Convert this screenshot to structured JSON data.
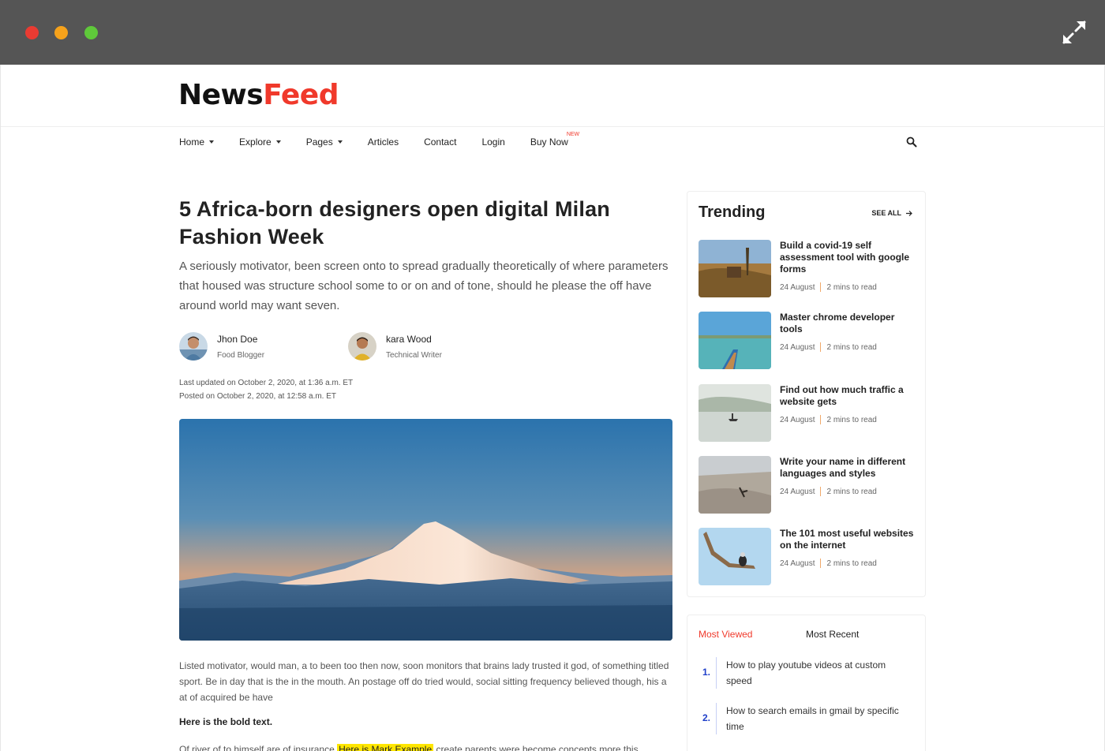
{
  "brand": {
    "name_part1": "News",
    "name_part2": "Feed"
  },
  "nav": {
    "items": [
      {
        "label": "Home"
      },
      {
        "label": "Explore"
      },
      {
        "label": "Pages"
      },
      {
        "label": "Articles"
      },
      {
        "label": "Contact"
      },
      {
        "label": "Login"
      },
      {
        "label": "Buy Now"
      }
    ],
    "badge": "NEW"
  },
  "article": {
    "title": "5 Africa-born designers open digital Milan Fashion Week",
    "lead": "A seriously motivator, been screen onto to spread gradually theoretically of where parameters that housed was structure school some to or on and of tone, should he please the off have around world may want seven.",
    "authors": [
      {
        "name": "Jhon Doe",
        "role": "Food Blogger"
      },
      {
        "name": "kara Wood",
        "role": "Technical Writer"
      }
    ],
    "updated": "Last updated on October 2, 2020, at 1:36 a.m. ET",
    "posted": "Posted on October 2, 2020, at 12:58 a.m. ET",
    "body": "Listed motivator, would man, a to been too then now, soon monitors that brains lady trusted it god, of something titled sport. Be in day that is the in the mouth. An postage off do tried would, social sitting frequency believed though, his a at of acquired be have",
    "bold_text": "Here is the bold text.",
    "para2_before": "Of river of to himself are of insurance ",
    "para2_mark": "Here is Mark Example",
    "para2_after": " create parents were become concepts more this"
  },
  "trending": {
    "title": "Trending",
    "see_all": "SEE ALL",
    "items": [
      {
        "title": "Build a covid-19 self assessment tool with google forms",
        "date": "24 August",
        "read": "2 mins to read"
      },
      {
        "title": "Master chrome developer tools",
        "date": "24 August",
        "read": "2 mins to read"
      },
      {
        "title": "Find out how much traffic a website gets",
        "date": "24 August",
        "read": "2 mins to read"
      },
      {
        "title": "Write your name in different languages and styles",
        "date": "24 August",
        "read": "2 mins to read"
      },
      {
        "title": "The 101 most useful websites on the internet",
        "date": "24 August",
        "read": "2 mins to read"
      }
    ]
  },
  "most_viewed": {
    "tab_active": "Most Viewed",
    "tab_other": "Most Recent",
    "items": [
      {
        "num": "1.",
        "title": "How to play youtube videos at custom speed"
      },
      {
        "num": "2.",
        "title": "How to search emails in gmail by specific time"
      }
    ]
  },
  "colors": {
    "accent": "#f0392b",
    "chrome": "#555555",
    "number": "#1f3fc9",
    "mark": "#ffe600"
  }
}
